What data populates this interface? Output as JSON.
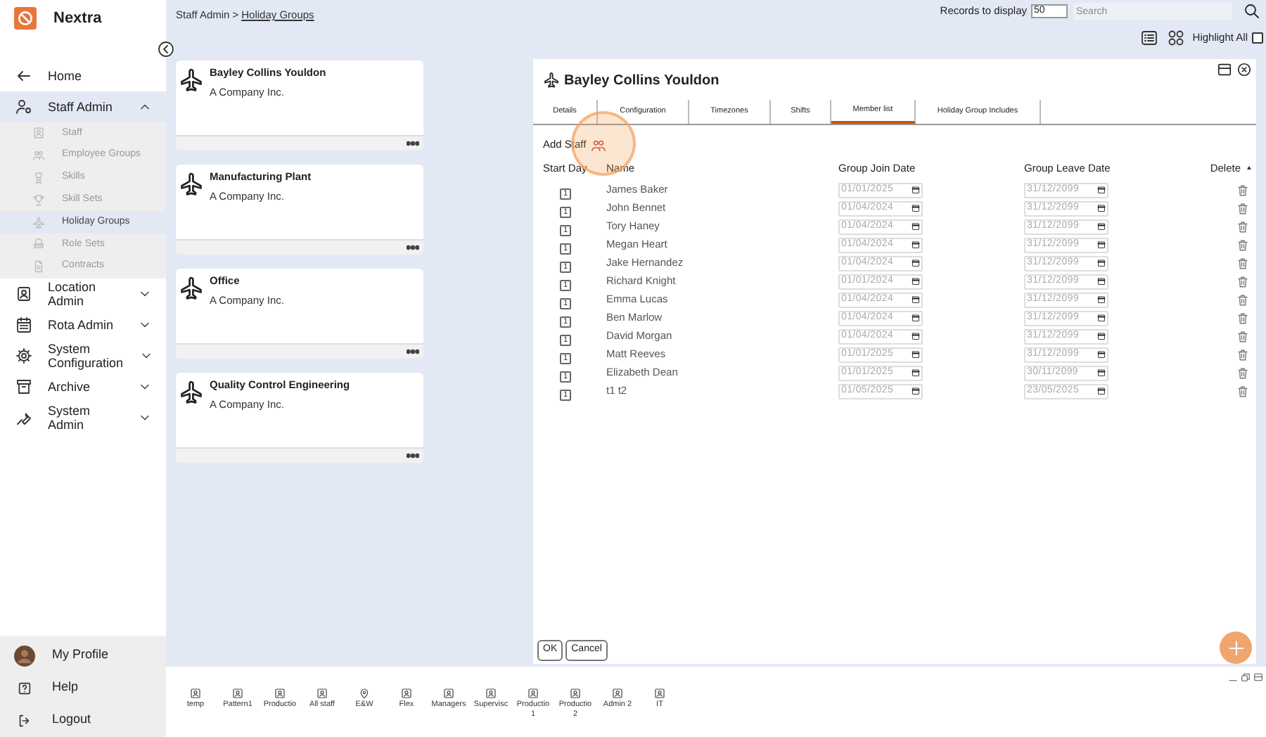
{
  "app": {
    "name": "Nextra"
  },
  "breadcrumb": {
    "parent": "Staff Admin",
    "separator": ">",
    "current": "Holiday Groups"
  },
  "sidebar": {
    "items": [
      {
        "label": "Home"
      },
      {
        "label": "Staff Admin",
        "expanded": true,
        "children": [
          {
            "label": "Staff",
            "selected": false
          },
          {
            "label": "Employee Groups",
            "selected": false
          },
          {
            "label": "Skills",
            "selected": false
          },
          {
            "label": "Skill Sets",
            "selected": false
          },
          {
            "label": "Holiday Groups",
            "selected": true
          },
          {
            "label": "Role Sets",
            "selected": false
          },
          {
            "label": "Contracts",
            "selected": false
          }
        ]
      },
      {
        "label": "Location Admin",
        "expanded": false
      },
      {
        "label": "Rota Admin",
        "expanded": false
      },
      {
        "label": "System Configuration",
        "expanded": false
      },
      {
        "label": "Archive",
        "expanded": false
      },
      {
        "label": "System Admin",
        "expanded": false
      }
    ],
    "footer": [
      {
        "label": "My Profile"
      },
      {
        "label": "Help"
      },
      {
        "label": "Logout"
      }
    ]
  },
  "toolbar": {
    "records_label": "Records to display",
    "records_value": "50",
    "search_placeholder": "Search",
    "highlight_all": {
      "label": "Highlight All",
      "checked": false
    }
  },
  "cards": [
    {
      "title": "Bayley Collins Youldon",
      "subtitle": "A Company Inc."
    },
    {
      "title": "Manufacturing Plant",
      "subtitle": "A Company Inc."
    },
    {
      "title": "Office",
      "subtitle": "A Company Inc."
    },
    {
      "title": "Quality Control Engineering",
      "subtitle": "A Company Inc."
    }
  ],
  "detail": {
    "title": "Bayley Collins Youldon",
    "tabs": [
      {
        "label": "Details",
        "selected": false
      },
      {
        "label": "Configuration",
        "selected": false
      },
      {
        "label": "Timezones",
        "selected": false
      },
      {
        "label": "Shifts",
        "selected": false
      },
      {
        "label": "Member list",
        "selected": true
      },
      {
        "label": "Holiday Group Includes",
        "selected": false
      }
    ],
    "add_staff": "Add Staff",
    "columns": [
      "Start Day",
      "Name",
      "Group Join Date",
      "Group Leave Date",
      "Delete"
    ],
    "rows": [
      {
        "start_day": "1",
        "name": "James Baker",
        "join": "01/01/2025",
        "leave": "31/12/2099"
      },
      {
        "start_day": "1",
        "name": "John Bennet",
        "join": "01/04/2024",
        "leave": "31/12/2099"
      },
      {
        "start_day": "1",
        "name": "Tory Haney",
        "join": "01/04/2024",
        "leave": "31/12/2099"
      },
      {
        "start_day": "1",
        "name": "Megan Heart",
        "join": "01/04/2024",
        "leave": "31/12/2099"
      },
      {
        "start_day": "1",
        "name": "Jake Hernandez",
        "join": "01/04/2024",
        "leave": "31/12/2099"
      },
      {
        "start_day": "1",
        "name": "Richard Knight",
        "join": "01/01/2024",
        "leave": "31/12/2099"
      },
      {
        "start_day": "1",
        "name": "Emma Lucas",
        "join": "01/04/2024",
        "leave": "31/12/2099"
      },
      {
        "start_day": "1",
        "name": "Ben Marlow",
        "join": "01/04/2024",
        "leave": "31/12/2099"
      },
      {
        "start_day": "1",
        "name": "David Morgan",
        "join": "01/04/2024",
        "leave": "31/12/2099"
      },
      {
        "start_day": "1",
        "name": "Matt Reeves",
        "join": "01/01/2025",
        "leave": "31/12/2099"
      },
      {
        "start_day": "1",
        "name": "Elizabeth Dean",
        "join": "01/01/2025",
        "leave": "30/11/2099"
      },
      {
        "start_day": "1",
        "name": "t1 t2",
        "join": "01/05/2025",
        "leave": "23/05/2025"
      }
    ],
    "buttons": [
      "OK",
      "Cancel"
    ]
  },
  "taskbar": [
    {
      "label": "temp",
      "kind": "person"
    },
    {
      "label": "Pattern1",
      "kind": "person"
    },
    {
      "label": "Productio",
      "kind": "person"
    },
    {
      "label": "All staff",
      "kind": "person"
    },
    {
      "label": "E&W",
      "kind": "pin"
    },
    {
      "label": "Flex",
      "kind": "person"
    },
    {
      "label": "Managers",
      "kind": "person"
    },
    {
      "label": "Supervisc",
      "kind": "person"
    },
    {
      "label": "Productio 1",
      "kind": "person"
    },
    {
      "label": "Productio 2",
      "kind": "person"
    },
    {
      "label": "Admin 2",
      "kind": "person"
    },
    {
      "label": "IT",
      "kind": "person"
    }
  ]
}
